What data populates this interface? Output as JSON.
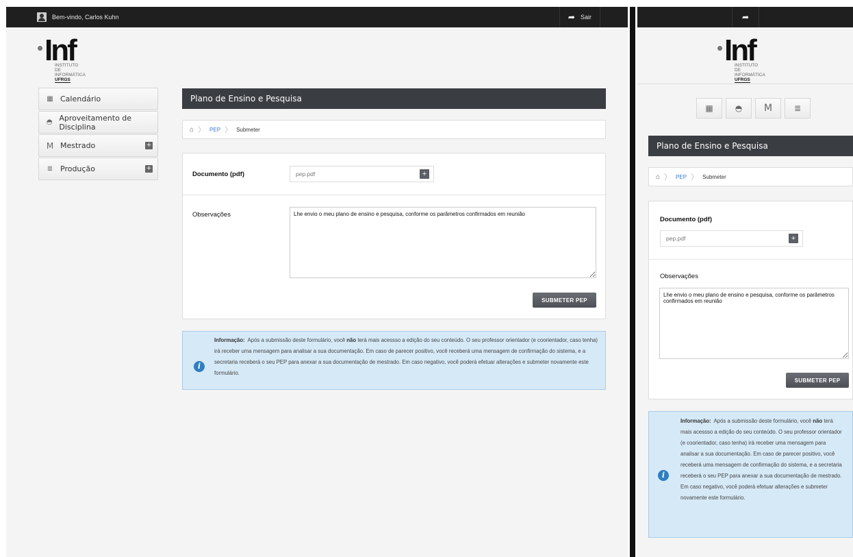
{
  "desktop": {
    "topbar": {
      "welcome": "Bem-vindo, Carlos Kuhn",
      "logout_label": "Sair"
    },
    "logo": {
      "word": "Inf",
      "line1": "INSTITUTO",
      "line2": "DE INFORMÁTICA",
      "line3": "UFRGS"
    },
    "sidebar": {
      "items": [
        {
          "label": "Calendário",
          "icon": "calendar-icon"
        },
        {
          "label": "Aproveitamento de Disciplina",
          "icon": "cap-icon"
        },
        {
          "label": "Mestrado",
          "icon": "m-icon",
          "expand": "+"
        },
        {
          "label": "Produção",
          "icon": "stack-icon",
          "expand": "+"
        }
      ]
    },
    "page_title": "Plano de Ensino e Pesquisa",
    "breadcrumb": {
      "link": "PEP",
      "current": "Submeter"
    },
    "form": {
      "doc_label": "Documento (pdf)",
      "doc_value": "pep.pdf",
      "doc_add": "+",
      "obs_label": "Observações",
      "obs_value": "Lhe envio o meu plano de ensino e pesquisa, conforme os parâmetros confirmados em reunião",
      "submit_label": "SUBMETER PEP"
    },
    "info": {
      "title": "Informação:",
      "text_before": "Após a submissão deste formulário, você",
      "emphasis": "não",
      "text_after": "terá mais acessso a edição do seu conteúdo. O seu professor orientador (e coorientador, caso tenha) irá receber uma mensagem para analisar a sua documentação. Em caso de parecer positivo, você receberá uma mensagem de confirmação do sistema, e a secretaria receberá o seu PEP para anexar a sua documentação de mestrado. Em caso negativo, você poderá efetuar alterações e submeter novamente este formulário."
    }
  },
  "mobile": {
    "page_title": "Plano de Ensino e Pesquisa",
    "breadcrumb": {
      "link": "PEP",
      "current": "Submeter"
    },
    "icons": [
      "calendar-icon",
      "cap-icon",
      "m-icon",
      "stack-icon"
    ],
    "m_letter": "M",
    "form": {
      "doc_label": "Documento (pdf)",
      "doc_value": "pep.pdf",
      "doc_add": "+",
      "obs_label": "Observações",
      "obs_value": "Lhe envio o meu plano de ensino e pesquisa, conforme os parâmetros confirmados em reunião",
      "submit_label": "SUBMETER PEP"
    }
  },
  "colors": {
    "topbar": "#1f1f1f",
    "titlebar": "#3a3d42",
    "info_bg": "#d6e9f7",
    "link": "#3a7bd5"
  }
}
